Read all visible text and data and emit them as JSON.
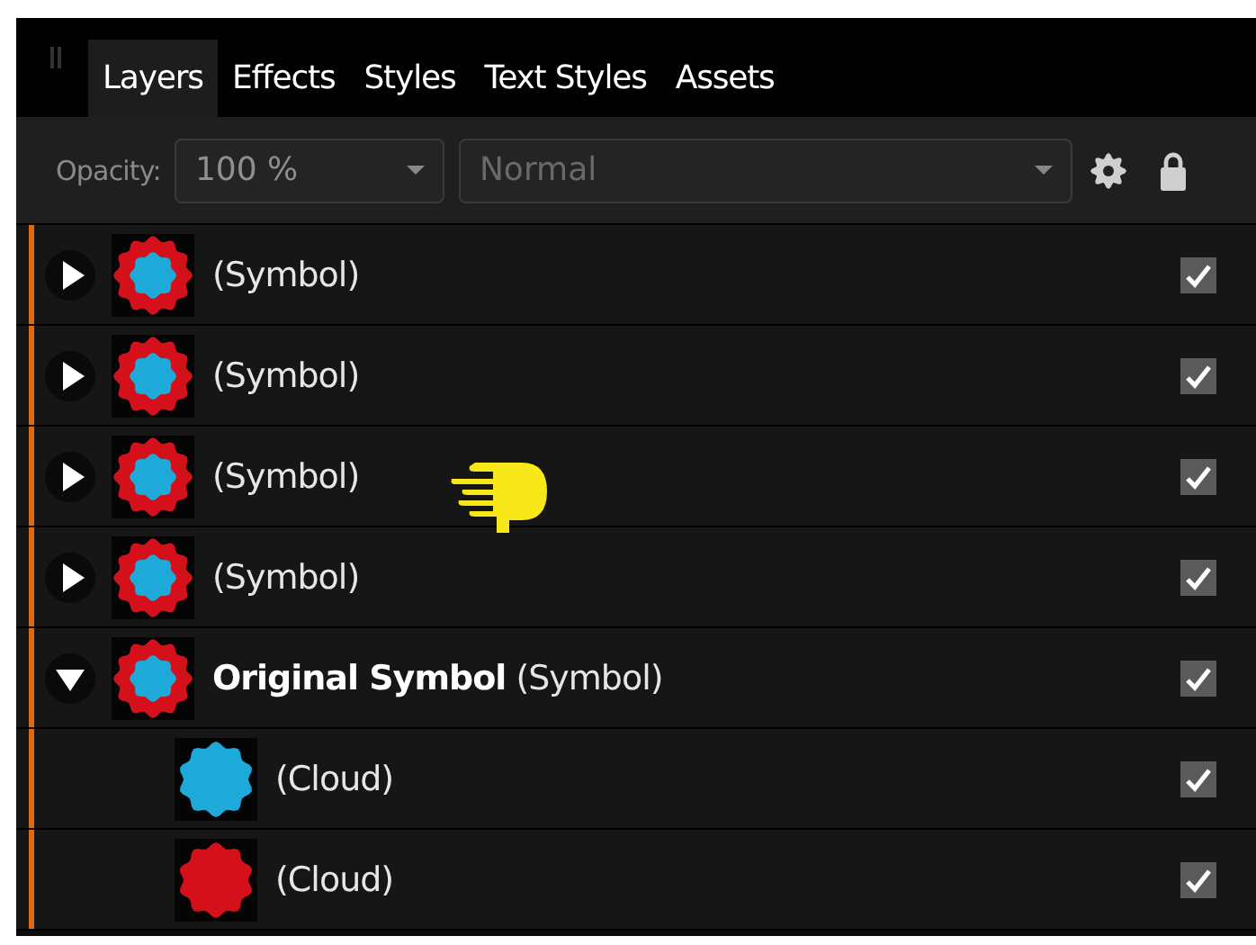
{
  "tabs": [
    {
      "label": "Layers",
      "selected": true
    },
    {
      "label": "Effects",
      "selected": false
    },
    {
      "label": "Styles",
      "selected": false
    },
    {
      "label": "Text Styles",
      "selected": false
    },
    {
      "label": "Assets",
      "selected": false
    }
  ],
  "toolbar": {
    "opacity_label": "Opacity:",
    "opacity_value": "100 %",
    "blend_mode": "Normal"
  },
  "layers": [
    {
      "name": "(Symbol)",
      "kind": "symbol",
      "expanded": false,
      "visible": true
    },
    {
      "name": "(Symbol)",
      "kind": "symbol",
      "expanded": false,
      "visible": true
    },
    {
      "name": "(Symbol)",
      "kind": "symbol",
      "expanded": false,
      "visible": true
    },
    {
      "name": "(Symbol)",
      "kind": "symbol",
      "expanded": false,
      "visible": true
    },
    {
      "name": "**Original Symbol** (Symbol)",
      "kind": "symbol",
      "expanded": true,
      "visible": true,
      "children": [
        {
          "name": "(Cloud)",
          "kind": "cloud",
          "color": "#1eaad8",
          "visible": true
        },
        {
          "name": "(Cloud)",
          "kind": "cloud",
          "color": "#d4101a",
          "visible": true
        }
      ]
    }
  ]
}
